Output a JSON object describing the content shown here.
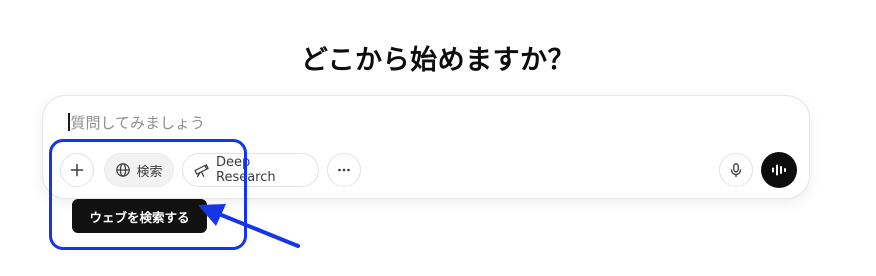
{
  "page": {
    "title": "どこから始めますか？"
  },
  "composer": {
    "placeholder": "質問してみましょう"
  },
  "toolbar": {
    "add_icon": "plus-icon",
    "search_label": "検索",
    "search_icon": "globe-icon",
    "deep_research_label": "Deep Research",
    "deep_research_icon": "telescope-icon",
    "more_icon": "ellipsis-icon",
    "mic_icon": "microphone-icon",
    "voice_icon": "voice-waveform-icon"
  },
  "tooltip": {
    "text": "ウェブを検索する"
  },
  "annotation": {
    "color": "#1436e6"
  }
}
